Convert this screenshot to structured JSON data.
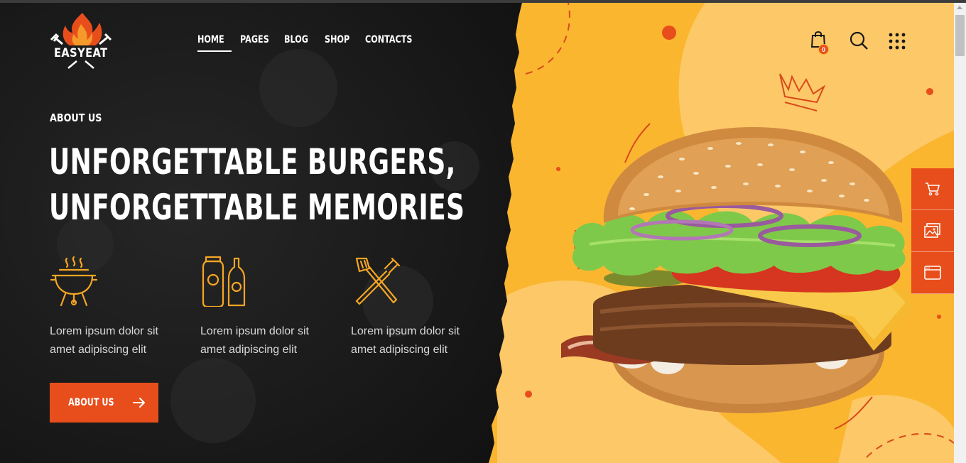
{
  "brand": {
    "name": "EASYEAT"
  },
  "nav": {
    "items": [
      {
        "label": "HOME",
        "active": true
      },
      {
        "label": "PAGES",
        "active": false
      },
      {
        "label": "BLOG",
        "active": false
      },
      {
        "label": "SHOP",
        "active": false
      },
      {
        "label": "CONTACTS",
        "active": false
      }
    ]
  },
  "header_icons": {
    "cart_count": "0",
    "icons": [
      "shopping-bag-icon",
      "search-icon",
      "grid-menu-icon"
    ]
  },
  "hero": {
    "eyebrow": "ABOUT US",
    "headline_line1": "UNFORGETTABLE BURGERS,",
    "headline_line2": "UNFORGETTABLE MEMORIES",
    "features": [
      {
        "icon": "grill-icon",
        "line1": "Lorem ipsum dolor sit",
        "line2": "amet adipiscing elit"
      },
      {
        "icon": "sauce-bottles-icon",
        "line1": "Lorem ipsum dolor sit",
        "line2": "amet adipiscing elit"
      },
      {
        "icon": "spatula-fork-icon",
        "line1": "Lorem ipsum dolor sit",
        "line2": "amet adipiscing elit"
      }
    ],
    "cta_label": "ABOUT US"
  },
  "side_tools": [
    "cart-icon",
    "gallery-icon",
    "browser-window-icon"
  ],
  "colors": {
    "accent": "#e84e1b",
    "dark": "#1a1a1a",
    "yellow": "#fbb630",
    "light_yellow": "#fdc867",
    "icon_gold": "#f5a623"
  }
}
